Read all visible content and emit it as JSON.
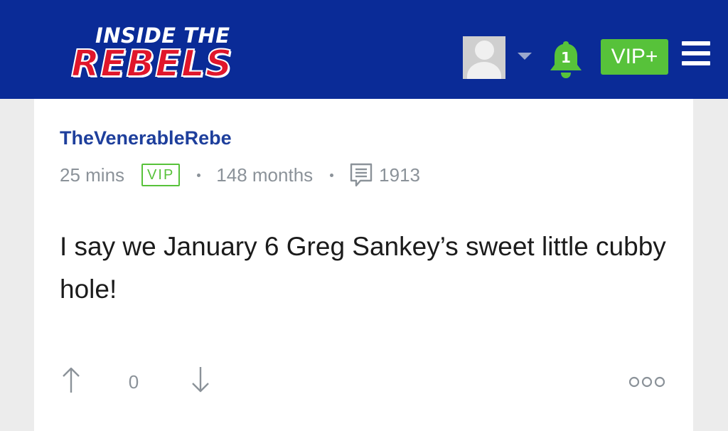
{
  "header": {
    "logo": {
      "line1": "INSIDE THE",
      "line2": "REBELS"
    },
    "avatar_icon": "user-avatar-placeholder",
    "dropdown_icon": "caret-down-icon",
    "notifications": {
      "icon": "bell-icon",
      "count": "1"
    },
    "vip_button_label": "VIP+",
    "menu_icon": "hamburger-menu-icon",
    "colors": {
      "background": "#0a2b97",
      "logo_red": "#e0162b",
      "accent_green": "#57c23a"
    }
  },
  "post": {
    "username": "TheVenerableRebe",
    "time_ago": "25 mins",
    "badge": "VIP",
    "membership": "148 months",
    "post_count": "1913",
    "body": "I say we January 6 Greg Sankey’s sweet little cubby hole!",
    "votes": {
      "score": "0",
      "upvote_icon": "arrow-up-icon",
      "downvote_icon": "arrow-down-icon"
    },
    "more_icon": "more-options-icon"
  }
}
